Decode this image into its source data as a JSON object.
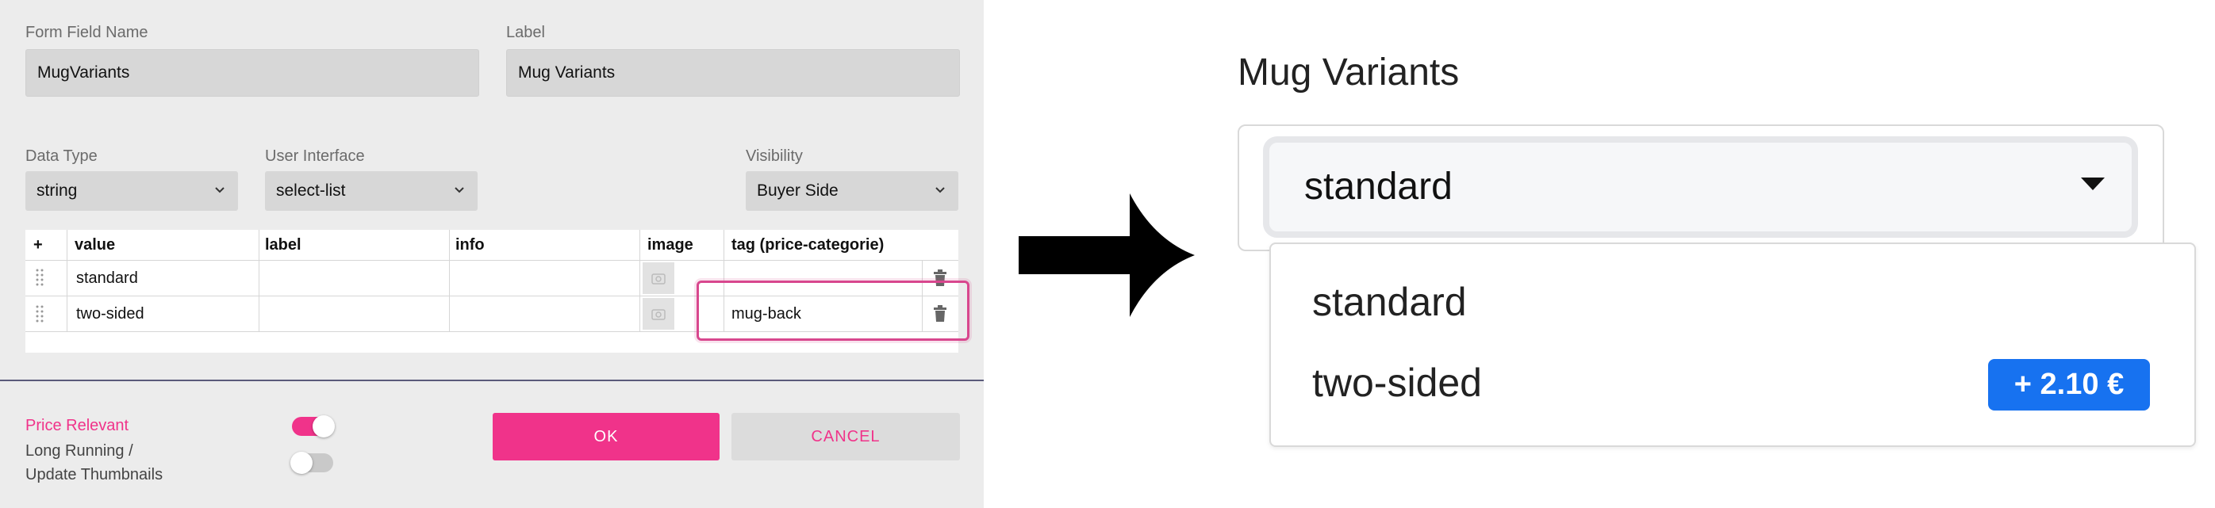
{
  "form": {
    "field_name_label": "Form Field Name",
    "field_name_value": "MugVariants",
    "label_label": "Label",
    "label_value": "Mug Variants",
    "data_type_label": "Data Type",
    "data_type_value": "string",
    "ui_label": "User Interface",
    "ui_value": "select-list",
    "visibility_label": "Visibility",
    "visibility_value": "Buyer Side"
  },
  "table": {
    "headers": [
      "+",
      "value",
      "label",
      "info",
      "image",
      "tag (price-categorie)"
    ],
    "rows": [
      {
        "value": "standard",
        "label": "",
        "info": "",
        "tag": ""
      },
      {
        "value": "two-sided",
        "label": "",
        "info": "",
        "tag": "mug-back"
      }
    ]
  },
  "options": {
    "price_relevant_label": "Price Relevant",
    "price_relevant_on": true,
    "long_running_label_1": "Long Running /",
    "long_running_label_2": "Update Thumbnails",
    "long_running_on": false
  },
  "buttons": {
    "ok": "OK",
    "cancel": "CANCEL"
  },
  "preview": {
    "title": "Mug Variants",
    "selected": "standard",
    "options": [
      "standard",
      "two-sided"
    ],
    "price_badge": "+ 2.10 €"
  },
  "colors": {
    "accent": "#f0338a",
    "badge": "#1772f0",
    "highlight": "#d8478e"
  }
}
